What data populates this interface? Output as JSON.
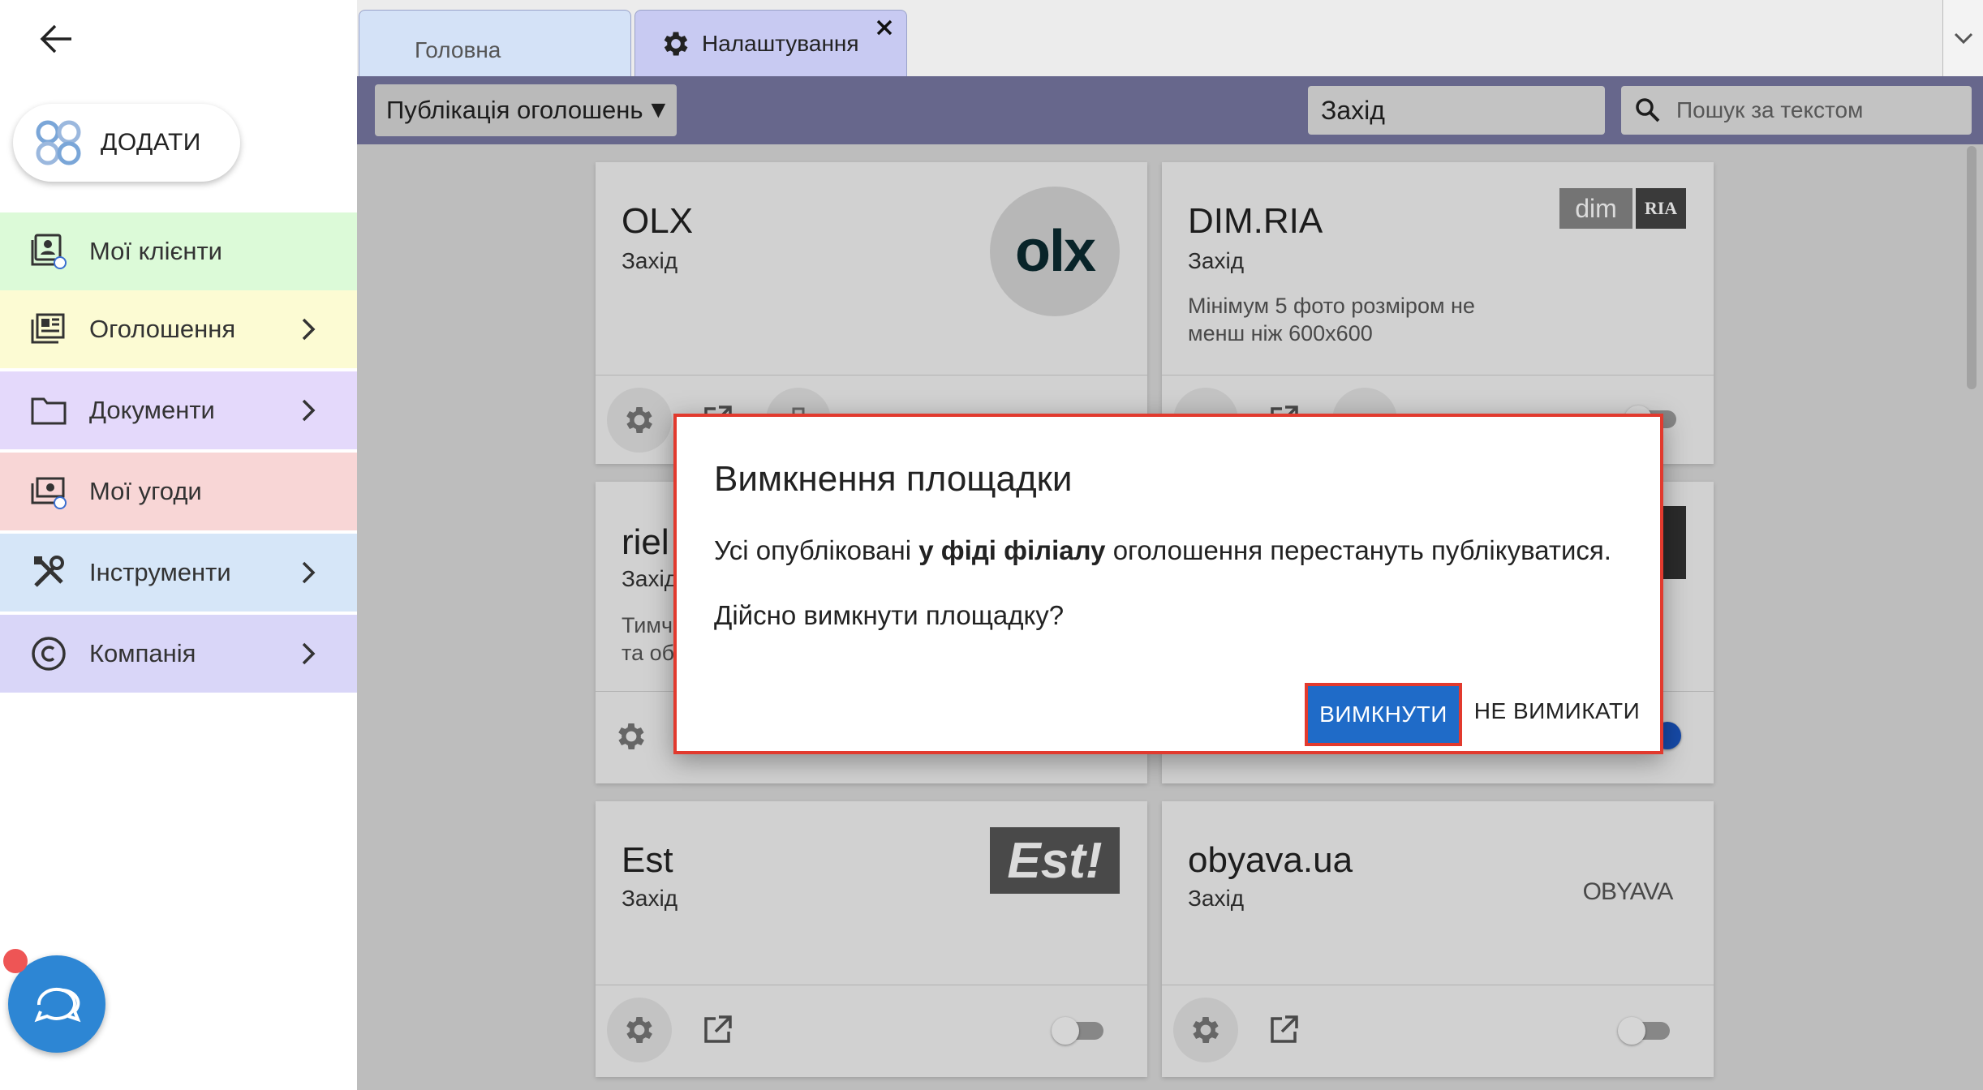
{
  "sidebar": {
    "add_label": "ДОДАТИ",
    "items": [
      {
        "label": "Мої клієнти",
        "color": "#dcfad8",
        "icon": "clients-icon",
        "has_chevron": false
      },
      {
        "label": "Оголошення",
        "color": "#fcfbd3",
        "icon": "listings-icon",
        "has_chevron": true
      },
      {
        "label": "Документи",
        "color": "#e4d9fb",
        "icon": "folder-icon",
        "has_chevron": true
      },
      {
        "label": "Мої угоди",
        "color": "#f8d6d6",
        "icon": "deals-icon",
        "has_chevron": false
      },
      {
        "label": "Інструменти",
        "color": "#d6e6f8",
        "icon": "tools-icon",
        "has_chevron": true
      },
      {
        "label": "Компанія",
        "color": "#d9d6f8",
        "icon": "copyright-icon",
        "has_chevron": true
      }
    ]
  },
  "tabs": [
    {
      "label": "Головна",
      "active": false
    },
    {
      "label": "Налаштування",
      "active": true
    }
  ],
  "toolbar": {
    "publication_select": "Публікація оголошень",
    "region": "Захід",
    "search_placeholder": "Пошук за текстом"
  },
  "cards": [
    {
      "title": "OLX",
      "region": "Захід",
      "note": "",
      "logo": "olx-logo",
      "enabled": false
    },
    {
      "title": "DIM.RIA",
      "region": "Захід",
      "note_line1": "Мінімум 5 фото розміром не",
      "note_line2": "менш ніж 600x600",
      "logo": "dimria-logo",
      "enabled": false
    },
    {
      "title": "riel",
      "region": "Захід",
      "note_line1": "Тимч",
      "note_line2": "та об",
      "logo": "rieltor-logo",
      "enabled": false
    },
    {
      "title": "",
      "region": "",
      "note": "",
      "logo": "dark-logo",
      "enabled": true
    },
    {
      "title": "Est",
      "region": "Захід",
      "note": "",
      "logo": "est-logo",
      "enabled": false
    },
    {
      "title": "obyava.ua",
      "region": "Захід",
      "note": "",
      "logo": "obyava-logo",
      "enabled": false
    }
  ],
  "logos": {
    "olx": "olx",
    "dim": "dim",
    "ria": "RIA",
    "est": "Est!",
    "obyava": "OBYAVA"
  },
  "dialog": {
    "title": "Вимкнення площадки",
    "body_prefix": "Усі опубліковані ",
    "body_bold": "у фіді філіалу",
    "body_suffix": " оголошення перестануть публікуватися.",
    "question": "Дійсно вимкнути площадку?",
    "confirm_label": "ВИМКНУТИ",
    "cancel_label": "НЕ ВИМИКАТИ"
  },
  "colors": {
    "accent": "#1f6bc8",
    "highlight": "#e23a2e",
    "toolbar": "#7879a3"
  }
}
